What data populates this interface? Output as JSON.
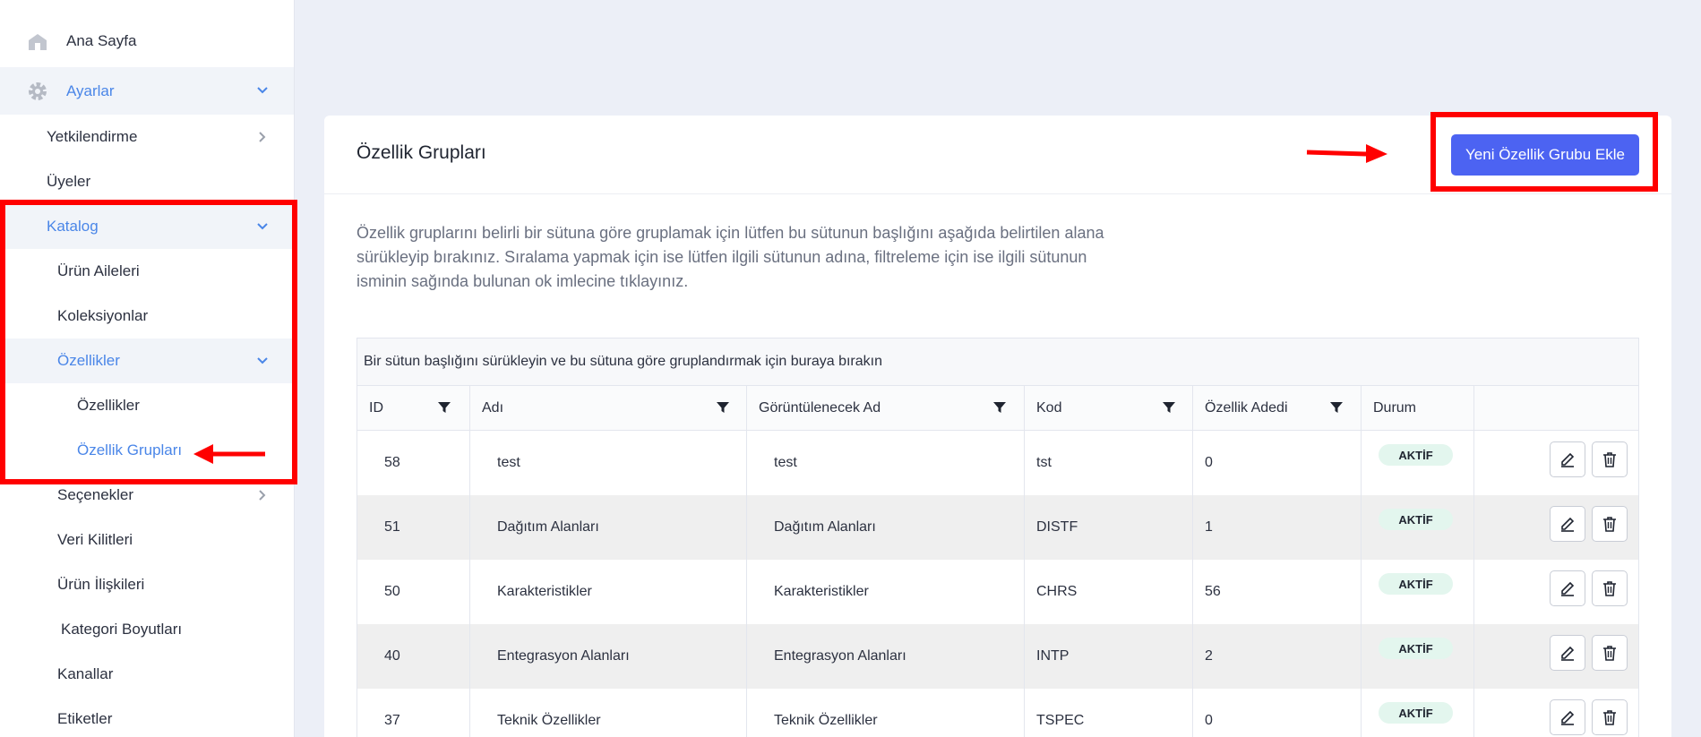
{
  "sidebar": {
    "items": [
      {
        "label": "Ana Sayfa"
      },
      {
        "label": "Ayarlar"
      },
      {
        "label": "Yetkilendirme"
      },
      {
        "label": "Üyeler"
      },
      {
        "label": "Katalog"
      },
      {
        "label": "Ürün Aileleri"
      },
      {
        "label": "Koleksiyonlar"
      },
      {
        "label": "Özellikler"
      },
      {
        "label": "Özellikler"
      },
      {
        "label": "Özellik Grupları"
      },
      {
        "label": "Seçenekler"
      },
      {
        "label": "Veri Kilitleri"
      },
      {
        "label": "Ürün İlişkileri"
      },
      {
        "label": "Kategori Boyutları"
      },
      {
        "label": "Kanallar"
      },
      {
        "label": "Etiketler"
      }
    ]
  },
  "page": {
    "title": "Özellik Grupları",
    "add_button": "Yeni Özellik Grubu Ekle",
    "description": "Özellik gruplarını belirli bir sütuna göre gruplamak için lütfen bu sütunun başlığını aşağıda belirtilen alana sürükleyip bırakınız. Sıralama yapmak için ise lütfen ilgili sütunun adına, filtreleme için ise ilgili sütunun isminin sağında bulunan ok imlecine tıklayınız."
  },
  "grid": {
    "group_panel": "Bir sütun başlığını sürükleyin ve bu sütuna göre gruplandırmak için buraya bırakın",
    "columns": [
      "ID",
      "Adı",
      "Görüntülenecek Ad",
      "Kod",
      "Özellik Adedi",
      "Durum"
    ],
    "rows": [
      {
        "id": "58",
        "name": "test",
        "display": "test",
        "code": "tst",
        "count": "0",
        "status": "AKTİF"
      },
      {
        "id": "51",
        "name": "Dağıtım Alanları",
        "display": "Dağıtım Alanları",
        "code": "DISTF",
        "count": "1",
        "status": "AKTİF"
      },
      {
        "id": "50",
        "name": "Karakteristikler",
        "display": "Karakteristikler",
        "code": "CHRS",
        "count": "56",
        "status": "AKTİF"
      },
      {
        "id": "40",
        "name": "Entegrasyon Alanları",
        "display": "Entegrasyon Alanları",
        "code": "INTP",
        "count": "2",
        "status": "AKTİF"
      },
      {
        "id": "37",
        "name": "Teknik Özellikler",
        "display": "Teknik Özellikler",
        "code": "TSPEC",
        "count": "0",
        "status": "AKTİF"
      }
    ]
  },
  "colors": {
    "accent": "#4a86e8",
    "primary": "#4c63f2",
    "annotation": "#ff0000",
    "badge_bg": "#e3f6ee"
  }
}
